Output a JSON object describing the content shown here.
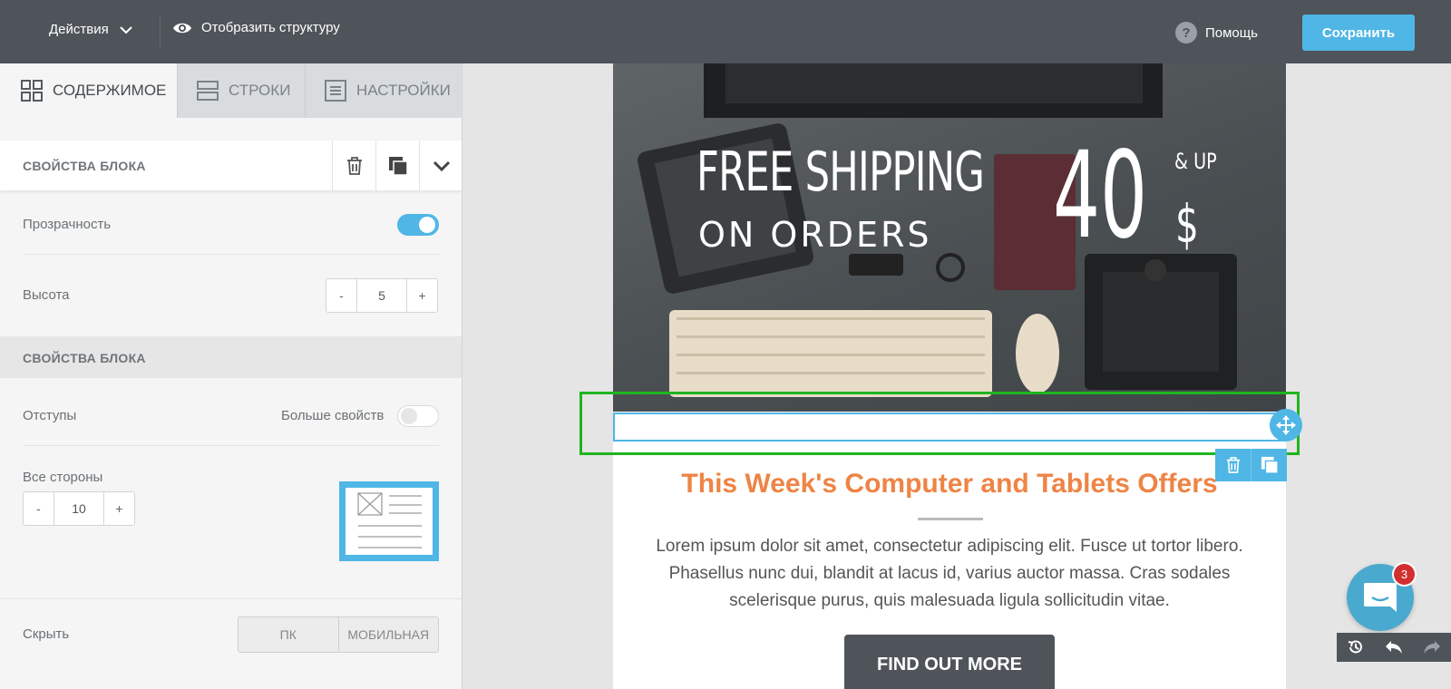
{
  "topbar": {
    "actions_label": "Действия",
    "structure_label": "Отобразить структуру",
    "help_label": "Помощь",
    "help_glyph": "?",
    "save_label": "Сохранить"
  },
  "tabs": [
    {
      "label": "СОДЕРЖИМОЕ",
      "active": true
    },
    {
      "label": "СТРОКИ",
      "active": false
    },
    {
      "label": "НАСТРОЙКИ",
      "active": false
    }
  ],
  "block_properties": {
    "title": "СВОЙСТВА БЛОКА",
    "transparency_label": "Прозрачность",
    "transparency_on": true,
    "height_label": "Высота",
    "height_value": "5",
    "minus": "-",
    "plus": "+"
  },
  "block_properties_2": {
    "title": "СВОЙСТВА БЛОКА",
    "padding_label": "Отступы",
    "more_props_label": "Больше свойств",
    "more_props_on": false,
    "all_sides_label": "Все стороны",
    "all_sides_value": "10"
  },
  "hide": {
    "label": "Скрыть",
    "options": [
      "ПК",
      "МОБИЛЬНАЯ"
    ]
  },
  "email": {
    "hero": {
      "line1": "FREE SHIPPING",
      "line2": "ON ORDERS",
      "amount": "40",
      "currency": "$",
      "suffix": "& UP"
    },
    "title": "This Week's Computer and Tablets Offers",
    "body": "Lorem ipsum dolor sit amet, consectetur adipiscing elit. Fusce ut tortor libero. Phasellus nunc dui, blandit at lacus id, varius auctor massa. Cras sodales scelerisque purus, quis malesuada ligula sollicitudin vitae.",
    "cta_label": "FIND OUT MORE"
  },
  "chat": {
    "badge_count": "3"
  },
  "colors": {
    "accent": "#4fb6e6",
    "topbar": "#4e5459",
    "title_orange": "#ee8445",
    "selection_green": "#1fb51f",
    "badge_red": "#d32f2f"
  },
  "icons": [
    "chevron-down-icon",
    "eye-icon",
    "help-icon",
    "grid-icon",
    "rows-icon",
    "settings-icon",
    "trash-icon",
    "duplicate-icon",
    "move-icon",
    "chat-icon",
    "history-icon",
    "undo-icon",
    "redo-icon"
  ]
}
